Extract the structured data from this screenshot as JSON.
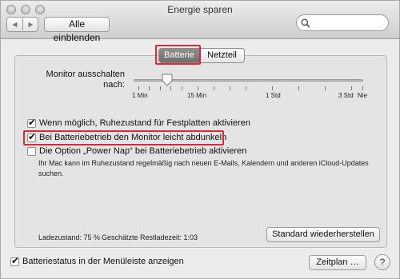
{
  "window": {
    "title": "Energie sparen",
    "show_all_label": "Alle einblenden",
    "back_icon": "chevron-left-icon",
    "forward_icon": "chevron-right-icon",
    "search": {
      "placeholder": "",
      "icon": "magnifier-icon"
    }
  },
  "tabs": [
    {
      "label": "Batterie",
      "active": true
    },
    {
      "label": "Netzteil",
      "active": false
    }
  ],
  "monitor_slider": {
    "label_line1": "Monitor ausschalten",
    "label_line2": "nach:",
    "value": "2 Min",
    "ticks": [
      "1 Min",
      "15 Min",
      "1 Std",
      "3 Std",
      "Nie"
    ]
  },
  "options": [
    {
      "label": "Wenn möglich, Ruhezustand für Festplatten aktivieren",
      "checked": true
    },
    {
      "label": "Bei Batteriebetrieb den Monitor leicht abdunkeln",
      "checked": true
    },
    {
      "label": "Die Option „Power Nap“ bei Batteriebetrieb aktivieren",
      "checked": false
    }
  ],
  "power_nap_note": "Ihr Mac kann im Ruhezustand regelmäßig nach neuen E-Mails, Kalendern und anderen iCloud-Updates suchen.",
  "status": {
    "charge_label": "Ladezustand: 75 %",
    "remaining_label": "Geschätzte Restladezeit: 1:03"
  },
  "restore_button": "Standard wiederherstellen",
  "menu_bar_checkbox": {
    "label": "Batteriestatus in der Menüleiste anzeigen",
    "checked": true
  },
  "schedule_button": "Zeitplan …",
  "help_button": "?",
  "colors": {
    "highlight": "#e0283a",
    "active_tab": "#7a7a7a"
  }
}
